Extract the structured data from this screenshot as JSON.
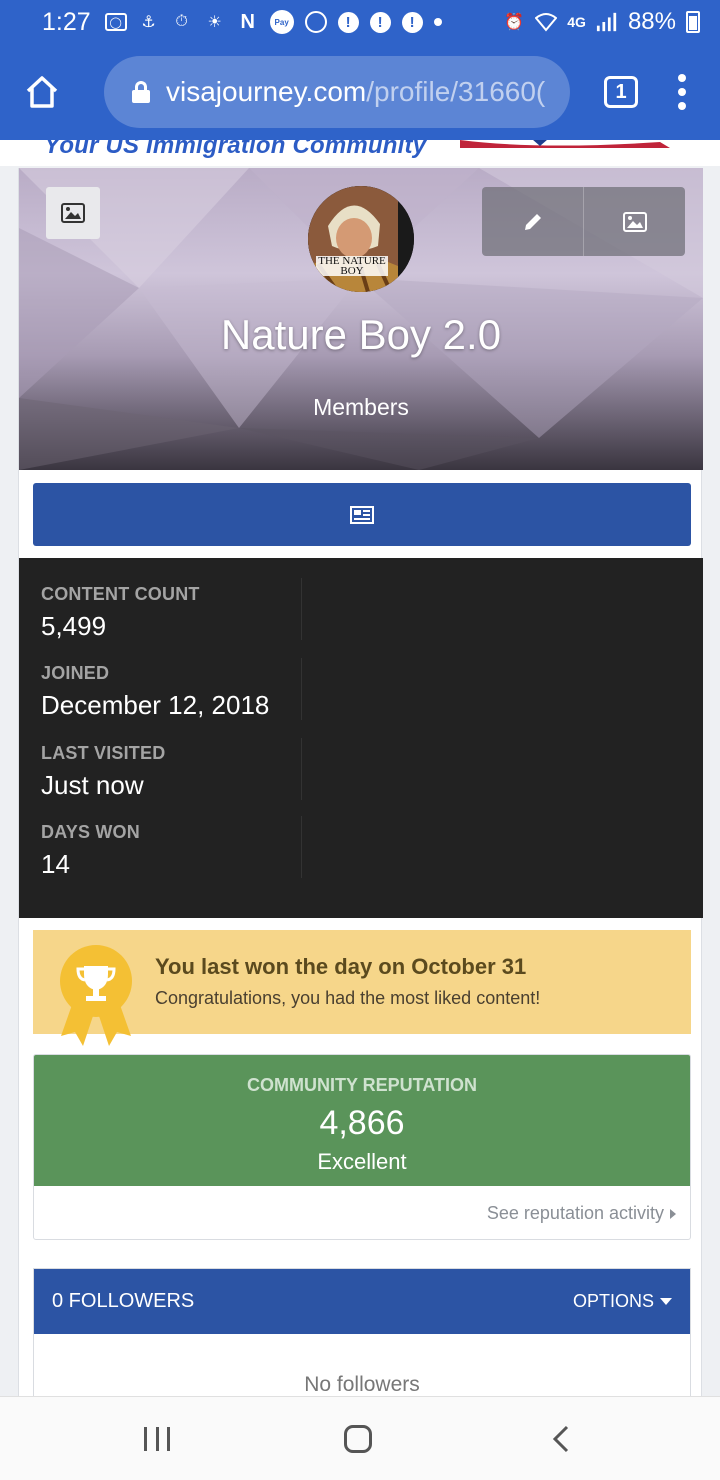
{
  "status_bar": {
    "time": "1:27",
    "network": "4G",
    "battery": "88%",
    "icons": [
      "toyota-icon",
      "app-icon",
      "activity-icon",
      "brightness-icon",
      "netflix-icon",
      "pay-icon",
      "podcast-icon",
      "alert-icon",
      "alert-icon",
      "alert-icon",
      "dot-icon",
      "alarm-icon",
      "wifi-icon",
      "signal-icon",
      "battery-icon"
    ],
    "letters": {
      "netflix": "N",
      "pay": "Pay",
      "alert": "!"
    }
  },
  "browser": {
    "url_host": "visajourney.com",
    "url_path": "/profile/31660(",
    "tab_count": "1"
  },
  "site": {
    "tagline": "Your US Immigration Community"
  },
  "profile": {
    "name": "Nature Boy 2.0",
    "group": "Members",
    "avatar_caption": "THE NATURE BOY"
  },
  "stats": [
    {
      "label": "CONTENT COUNT",
      "value": "5,499"
    },
    {
      "label": "JOINED",
      "value": "December 12, 2018"
    },
    {
      "label": "LAST VISITED",
      "value": "Just now"
    },
    {
      "label": "DAYS WON",
      "value": "14"
    }
  ],
  "day_won": {
    "title": "You last won the day on October 31",
    "text": "Congratulations, you had the most liked content!"
  },
  "reputation": {
    "label": "COMMUNITY REPUTATION",
    "value": "4,866",
    "description": "Excellent",
    "link": "See reputation activity"
  },
  "followers": {
    "title": "0 FOLLOWERS",
    "options": "OPTIONS",
    "empty": "No followers"
  },
  "colors": {
    "chrome_blue": "#2f63c9",
    "button_blue": "#2c54a4",
    "stats_bg": "#222222",
    "day_won_bg": "#f6d68a",
    "reputation_green": "#5a945a"
  }
}
